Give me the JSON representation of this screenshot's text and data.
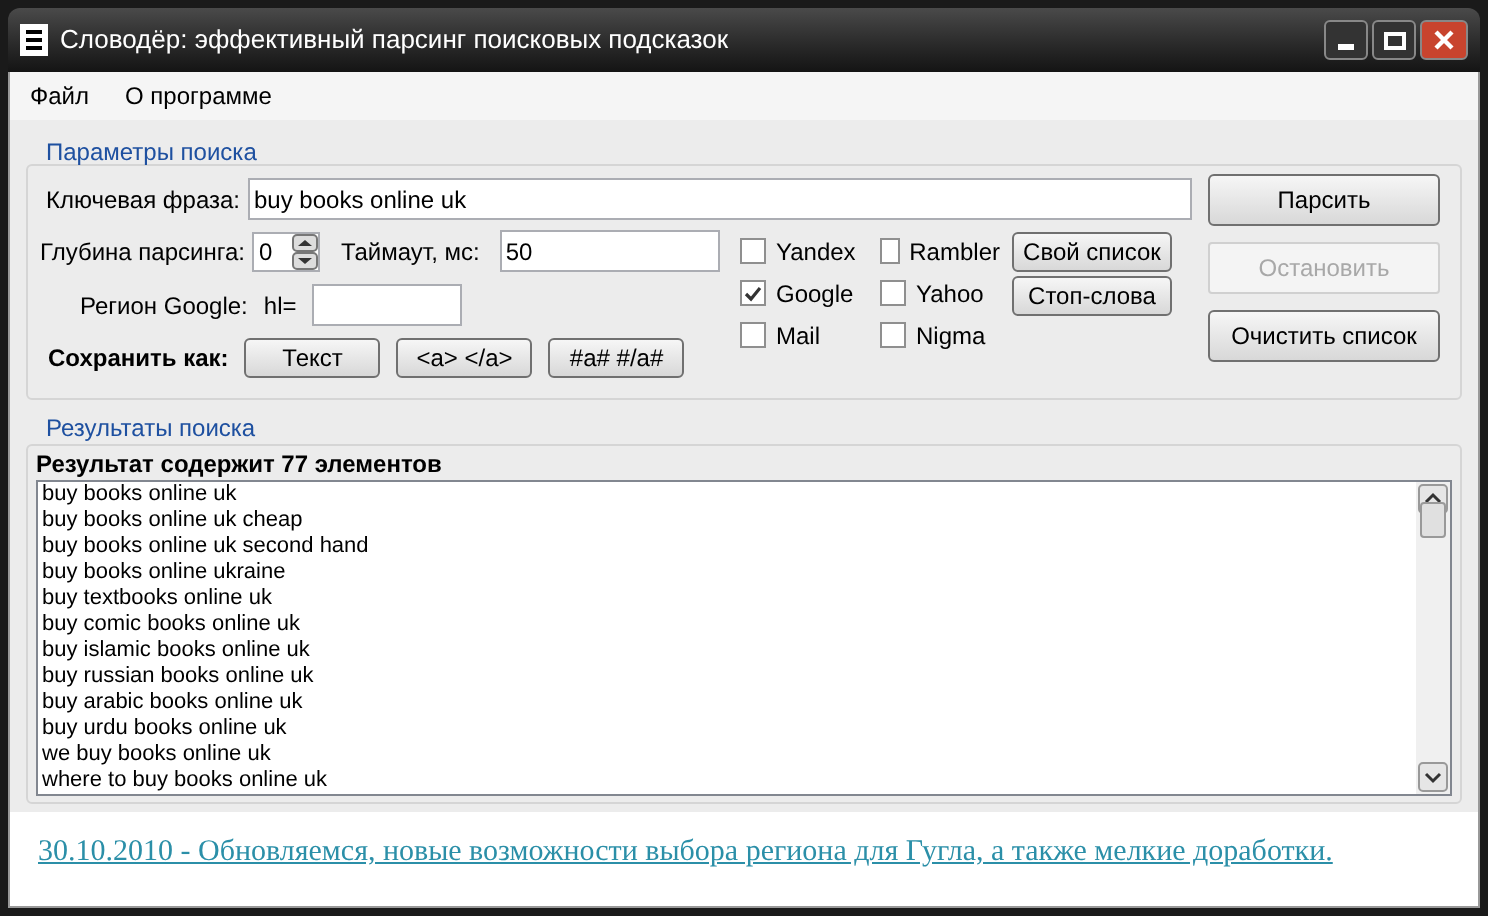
{
  "window": {
    "title": "Словодёр: эффективный парсинг поисковых подсказок"
  },
  "menu": [
    "Файл",
    "О программе"
  ],
  "params": {
    "title": "Параметры поиска",
    "phrase_label": "Ключевая фраза:",
    "phrase_value": "buy books online uk",
    "depth_label": "Глубина парсинга:",
    "depth_value": "0",
    "timeout_label": "Таймаут, мс:",
    "timeout_value": "50",
    "region_label": "Регион Google:",
    "region_prefix": "hl=",
    "save_label": "Сохранить как:",
    "save_buttons": [
      "Текст",
      "<a> </a>",
      "#a# #/a#"
    ],
    "engines": [
      {
        "label": "Yandex",
        "checked": false
      },
      {
        "label": "Google",
        "checked": true
      },
      {
        "label": "Mail",
        "checked": false
      },
      {
        "label": "Rambler",
        "checked": false
      },
      {
        "label": "Yahoo",
        "checked": false
      },
      {
        "label": "Nigma",
        "checked": false
      }
    ],
    "list_buttons": [
      "Свой список",
      "Стоп-слова"
    ],
    "actions": [
      {
        "label": "Парсить",
        "disabled": false
      },
      {
        "label": "Остановить",
        "disabled": true
      },
      {
        "label": "Очистить список",
        "disabled": false
      }
    ]
  },
  "results": {
    "title": "Результаты поиска",
    "summary": "Результат содержит 77 элементов",
    "items": [
      "buy books online uk",
      "buy books online uk cheap",
      "buy books online uk second hand",
      "buy books online ukraine",
      "buy textbooks online uk",
      "buy comic books online uk",
      "buy islamic books online uk",
      "buy russian books online uk",
      "buy arabic books online uk",
      "buy urdu books online uk",
      "we buy books online uk",
      "where to buy books online uk"
    ]
  },
  "news_link": "30.10.2010 - Обновляемся, новые возможности выбора региона для Гугла, а также мелкие доработки."
}
